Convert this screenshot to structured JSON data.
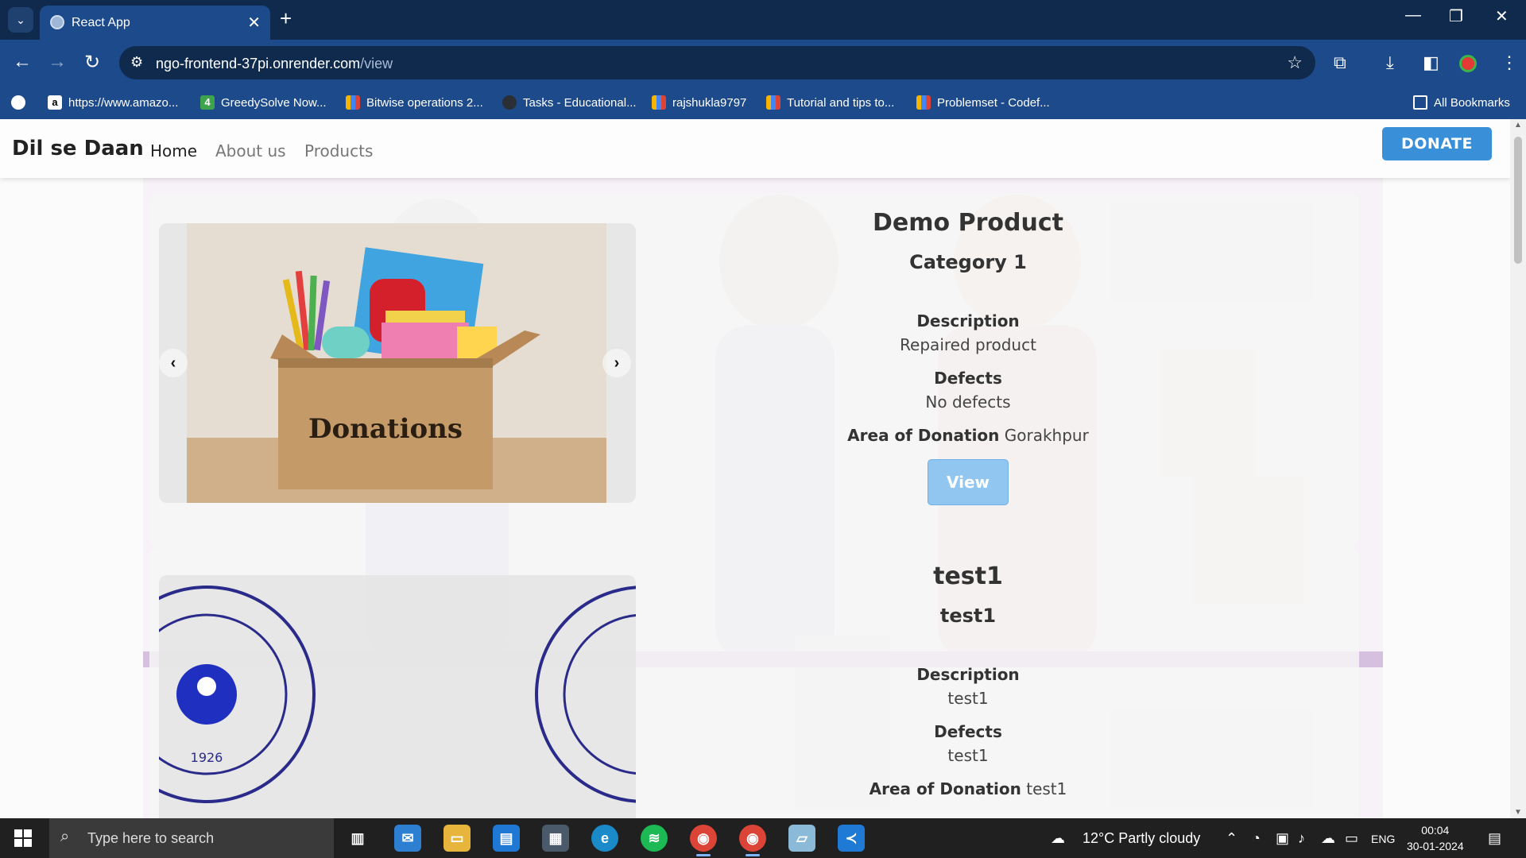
{
  "browser": {
    "tab_title": "React App",
    "url_host": "ngo-frontend-37pi.onrender.com",
    "url_path": "/view",
    "bookmarks": [
      "https://www.amazo...",
      "GreedySolve Now...",
      "Bitwise operations 2...",
      "Tasks - Educational...",
      "rajshukla9797",
      "Tutorial and tips to...",
      "Problemset - Codef..."
    ],
    "all_bookmarks": "All Bookmarks",
    "greedysolve_icon": "4"
  },
  "app": {
    "brand": "Dil se Daan",
    "nav": [
      "Home",
      "About us",
      "Products"
    ],
    "donate_label": "DONATE"
  },
  "products": [
    {
      "name": "Demo Product",
      "category": "Category 1",
      "description_label": "Description",
      "description": "Repaired product",
      "defects_label": "Defects",
      "defects": "No defects",
      "area_label": "Area of Donation",
      "area": "Gorakhpur",
      "view_label": "View",
      "image_text": "Donations"
    },
    {
      "name": "test1",
      "category": "test1",
      "description_label": "Description",
      "description": "test1",
      "defects_label": "Defects",
      "defects": "test1",
      "area_label": "Area of Donation",
      "area": "test1",
      "image_year": "1926"
    }
  ],
  "taskbar": {
    "search_placeholder": "Type here to search",
    "weather": "12°C  Partly cloudy",
    "language": "ENG",
    "time": "00:04",
    "date": "30-01-2024"
  },
  "colors": {
    "chrome_dark": "#0f2a4d",
    "chrome_toolbar": "#1d4a8a",
    "donate": "#3a8fd9",
    "view_button": "#90c6f0"
  }
}
